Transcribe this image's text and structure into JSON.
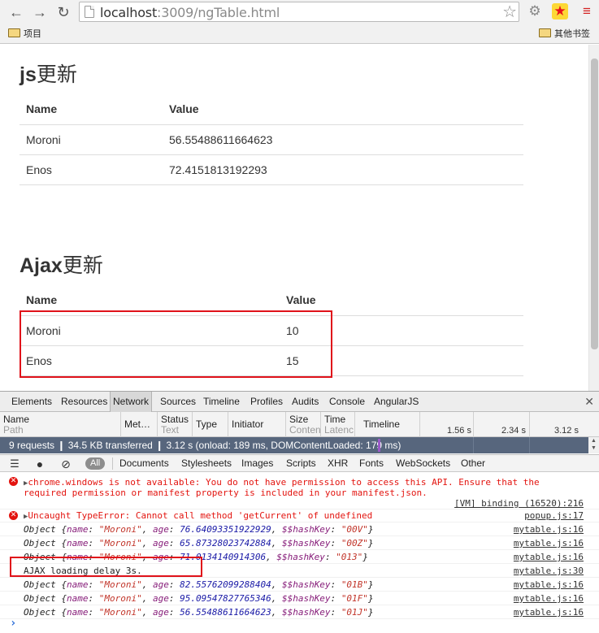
{
  "browser": {
    "url_host": "localhost",
    "url_rest": ":3009/ngTable.html",
    "bookmarks": {
      "left": "项目",
      "right": "其他书签"
    }
  },
  "page": {
    "section1": {
      "title_latin": "js",
      "title_cjk": "更新",
      "headers": [
        "Name",
        "Value"
      ],
      "rows": [
        {
          "name": "Moroni",
          "value": "56.55488611664623"
        },
        {
          "name": "Enos",
          "value": "72.4151813192293"
        }
      ]
    },
    "section2": {
      "title_latin": "Ajax",
      "title_cjk": "更新",
      "headers": [
        "Name",
        "Value"
      ],
      "rows": [
        {
          "name": "Moroni",
          "value": "10"
        },
        {
          "name": "Enos",
          "value": "15"
        }
      ]
    }
  },
  "devtools": {
    "tabs": [
      "Elements",
      "Resources",
      "Network",
      "Sources",
      "Timeline",
      "Profiles",
      "Audits",
      "Console",
      "AngularJS"
    ],
    "active_tab": "Network",
    "network_columns": {
      "name": [
        "Name",
        "Path"
      ],
      "method": "Met…",
      "status": [
        "Status",
        "Text"
      ],
      "type": "Type",
      "initiator": "Initiator",
      "size": [
        "Size",
        "Conten"
      ],
      "time": [
        "Time",
        "Latenc"
      ],
      "timeline": "Timeline",
      "ticks": [
        "1.56 s",
        "2.34 s",
        "3.12 s"
      ]
    },
    "summary": "9 requests ❙ 34.5 KB transferred ❙ 3.12 s (onload: 189 ms, DOMContentLoaded: 179 ms)",
    "console_filters": [
      "All",
      "Documents",
      "Stylesheets",
      "Images",
      "Scripts",
      "XHR",
      "Fonts",
      "WebSockets",
      "Other"
    ],
    "console": {
      "err1_line1": "chrome.windows is not available: You do not have permission to access this API. Ensure that the",
      "err1_line2": "required permission or manifest property is included in your manifest.json.",
      "err1_src": "[VM] binding (16520):216",
      "err2": "Uncaught TypeError: Cannot call method 'getCurrent' of undefined",
      "err2_src": "popup.js:17",
      "objects_before": [
        {
          "name": "\"Moroni\"",
          "age": "76.64093351922929",
          "key": "\"00V\""
        },
        {
          "name": "\"Moroni\"",
          "age": "65.87328023742884",
          "key": "\"00Z\""
        },
        {
          "name": "\"Moroni\"",
          "age": "71.0134140914306",
          "key": "\"013\""
        }
      ],
      "obj_src": "mytable.js:16",
      "ajax_log": "AJAX loading delay 3s.",
      "ajax_src": "mytable.js:30",
      "objects_after": [
        {
          "name": "\"Moroni\"",
          "age": "82.55762099288404",
          "key": "\"01B\""
        },
        {
          "name": "\"Moroni\"",
          "age": "95.09547827765346",
          "key": "\"01F\""
        },
        {
          "name": "\"Moroni\"",
          "age": "56.55488611664623",
          "key": "\"01J\""
        }
      ],
      "obj_label": "Object",
      "prompt": "›"
    }
  },
  "colors": {
    "highlight": "#e0121a",
    "error": "#e3140f",
    "summary_bar": "#57667d"
  }
}
